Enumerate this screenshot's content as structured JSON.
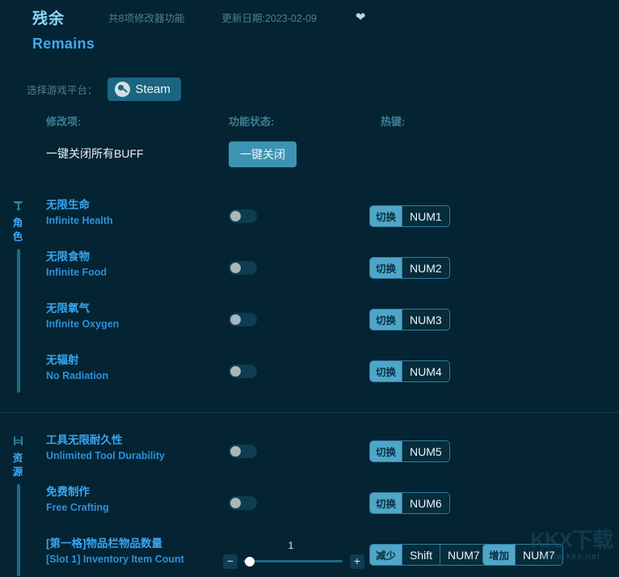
{
  "colors": {
    "background": "#042433",
    "accent_blue": "#39a5f0",
    "accent_teal": "#4fa6c8",
    "muted": "#4d7f94"
  },
  "header": {
    "title_cn": "残余",
    "title_en": "Remains",
    "feature_count": "共8项修改器功能",
    "update_date": "更新日期:2023-02-09",
    "favorite_icon": "heart-icon"
  },
  "platform": {
    "label": "选择游戏平台：",
    "selected": "Steam",
    "icon": "steam-icon"
  },
  "columns": {
    "name": "修改项:",
    "status": "功能状态:",
    "hotkey": "热键:"
  },
  "onekey": {
    "label": "一键关闭所有BUFF",
    "button": "一键关闭"
  },
  "sections": [
    {
      "rail_icon": "character-icon",
      "rail_label": "角色",
      "rows": [
        {
          "cn": "无限生命",
          "en": "Infinite Health",
          "toggle": false,
          "type": "toggle",
          "hotkeys": [
            {
              "action": "切换",
              "keys": [
                "NUM1"
              ]
            }
          ]
        },
        {
          "cn": "无限食物",
          "en": "Infinite Food",
          "toggle": false,
          "type": "toggle",
          "hotkeys": [
            {
              "action": "切换",
              "keys": [
                "NUM2"
              ]
            }
          ]
        },
        {
          "cn": "无限氧气",
          "en": "Infinite Oxygen",
          "toggle": false,
          "type": "toggle",
          "hotkeys": [
            {
              "action": "切换",
              "keys": [
                "NUM3"
              ]
            }
          ]
        },
        {
          "cn": "无辐射",
          "en": "No Radiation",
          "toggle": false,
          "type": "toggle",
          "hotkeys": [
            {
              "action": "切换",
              "keys": [
                "NUM4"
              ]
            }
          ]
        }
      ]
    },
    {
      "rail_icon": "resource-icon",
      "rail_label": "资源",
      "rows": [
        {
          "cn": "工具无限耐久性",
          "en": "Unlimited Tool Durability",
          "toggle": false,
          "type": "toggle",
          "hotkeys": [
            {
              "action": "切换",
              "keys": [
                "NUM5"
              ]
            }
          ]
        },
        {
          "cn": "免费制作",
          "en": "Free Crafting",
          "toggle": false,
          "type": "toggle",
          "hotkeys": [
            {
              "action": "切换",
              "keys": [
                "NUM6"
              ]
            }
          ]
        },
        {
          "cn": "[第一格]物品栏物品数量",
          "en": "[Slot 1] Inventory Item Count",
          "type": "slider",
          "value": "1",
          "minus": "−",
          "plus": "+",
          "hotkeys": [
            {
              "action": "减少",
              "keys": [
                "Shift",
                "NUM7"
              ]
            },
            {
              "action": "增加",
              "keys": [
                "NUM7"
              ]
            }
          ]
        }
      ]
    }
  ],
  "watermark": {
    "big": "KKX下载",
    "small": "www.kkx.net"
  }
}
